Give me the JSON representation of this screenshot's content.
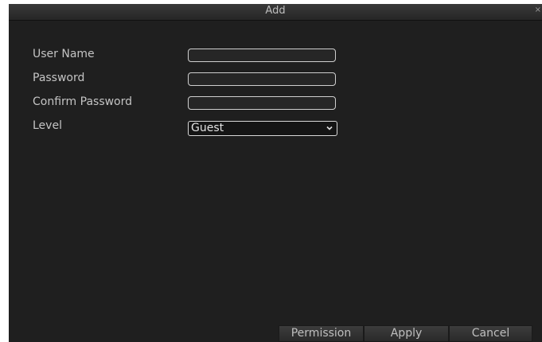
{
  "window": {
    "title": "Add",
    "close_glyph": "×"
  },
  "form": {
    "user_name_label": "User Name",
    "password_label": "Password",
    "confirm_password_label": "Confirm Password",
    "level_label": "Level",
    "user_name_value": "",
    "password_value": "",
    "confirm_password_value": "",
    "level_value": "Guest"
  },
  "buttons": {
    "permission": "Permission",
    "apply": "Apply",
    "cancel": "Cancel"
  },
  "colors": {
    "dialog_bg": "#1f1f1f",
    "text": "#c4c4c4",
    "field_border": "#cfcfcf"
  },
  "icons": {
    "close": "close-icon",
    "dropdown": "chevron-down-icon"
  }
}
